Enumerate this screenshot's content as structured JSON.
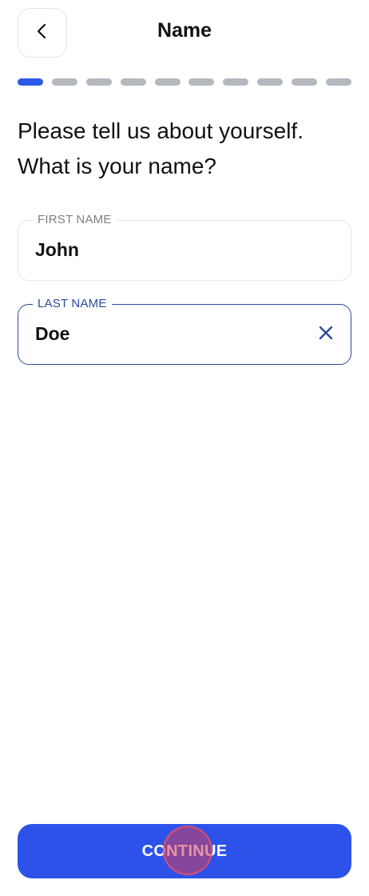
{
  "header": {
    "title": "Name",
    "back_icon": "chevron-left-icon"
  },
  "progress": {
    "total_steps": 10,
    "current_step": 1
  },
  "question": {
    "line1": "Please tell us about yourself.",
    "line2": "What is your name?"
  },
  "form": {
    "first_name": {
      "label": "FIRST NAME",
      "value": "John"
    },
    "last_name": {
      "label": "LAST NAME",
      "value": "Doe",
      "clear_icon": "close-icon"
    }
  },
  "footer": {
    "continue_label": "CONTINUE"
  },
  "colors": {
    "accent": "#2c52ea",
    "progress_inactive": "#b4b8bf",
    "focused_border": "#2a4a9e"
  }
}
